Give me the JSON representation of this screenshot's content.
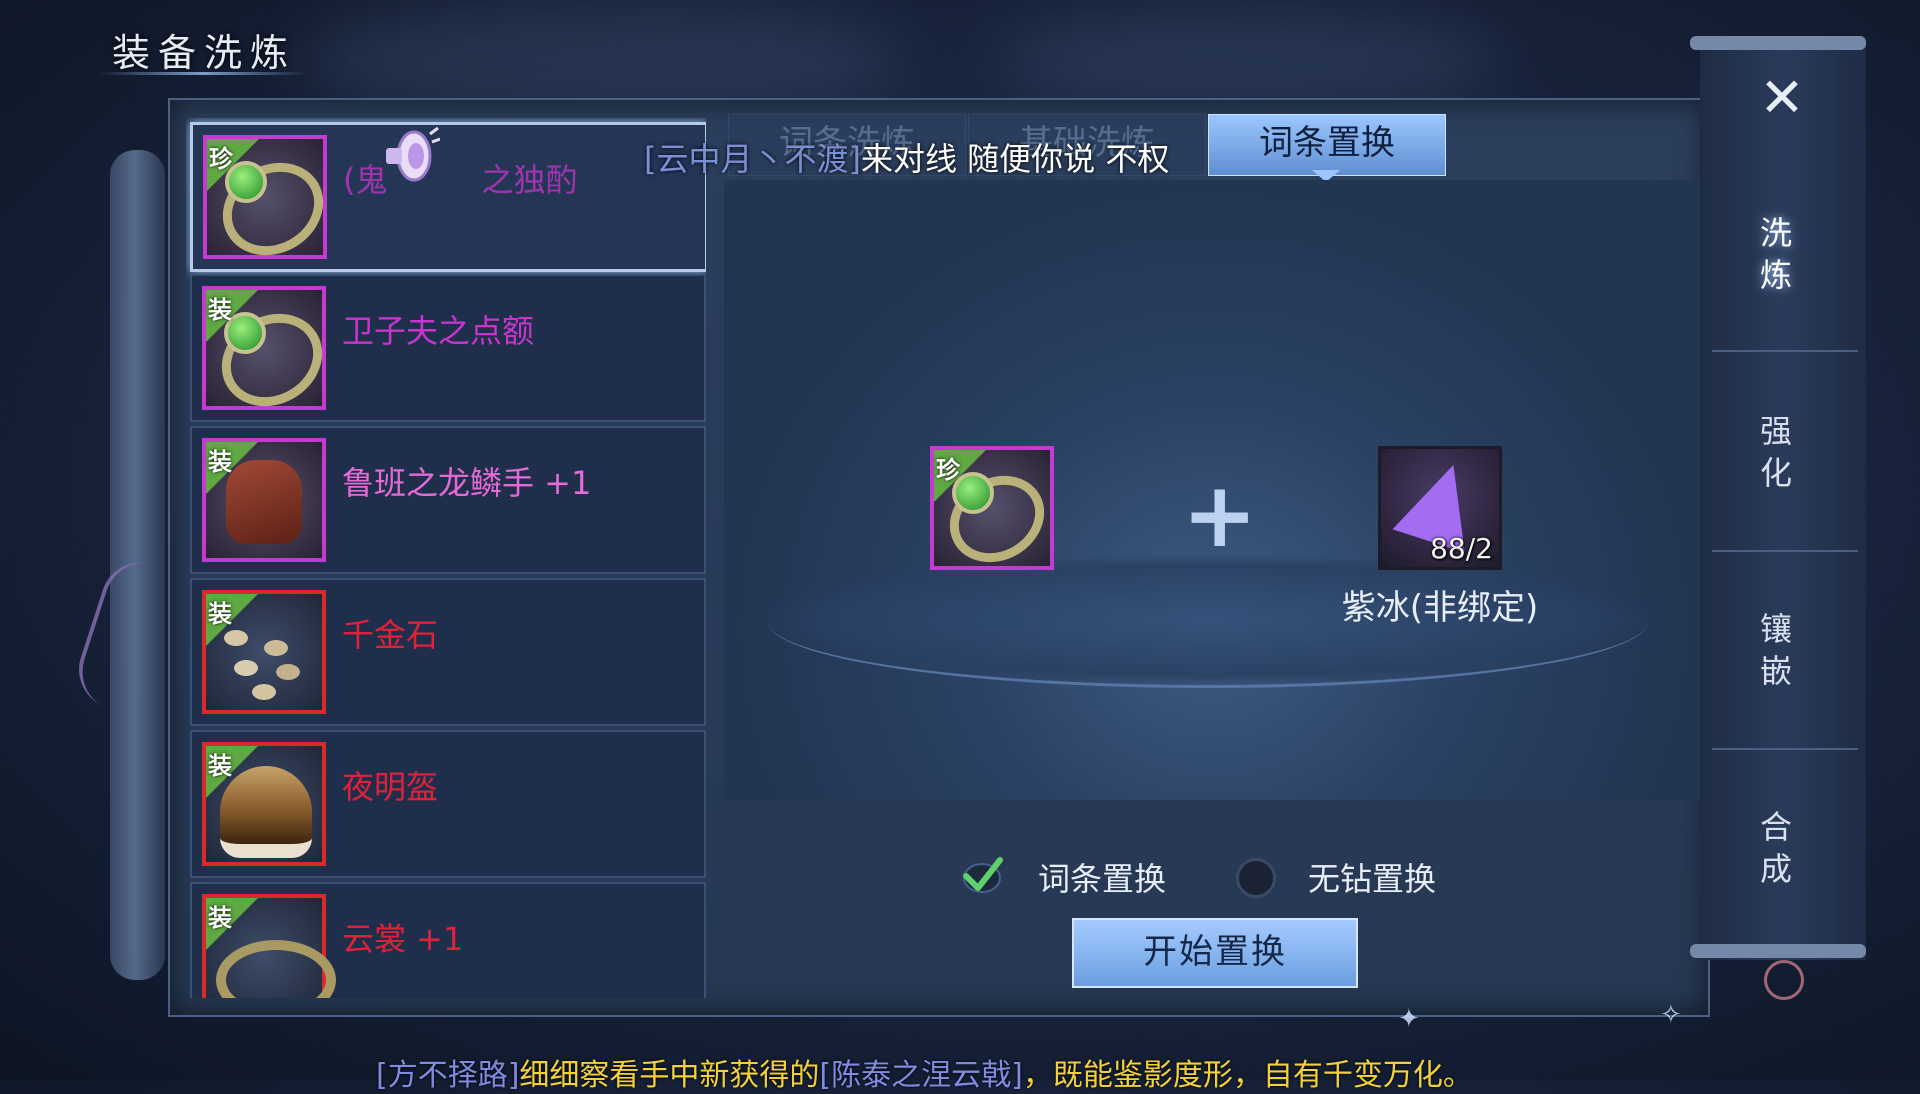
{
  "page_title": "装备洗炼",
  "items": [
    {
      "tag": "珍",
      "name": "(鬼",
      "name_rest": "之独酌",
      "color": "#c835cc",
      "frame": "purple",
      "art": "ring",
      "selected": true
    },
    {
      "tag": "装",
      "name": "卫子夫之点额",
      "color": "#c835cc",
      "frame": "purple",
      "art": "ring",
      "selected": false
    },
    {
      "tag": "装",
      "name": "鲁班之龙鳞手 +1",
      "color": "#e56ad6",
      "frame": "purple",
      "art": "glove",
      "selected": false
    },
    {
      "tag": "装",
      "name": "千金石",
      "color": "#e0213a",
      "frame": "red",
      "art": "stones",
      "selected": false
    },
    {
      "tag": "装",
      "name": "夜明盔",
      "color": "#e0213a",
      "frame": "red",
      "art": "hat",
      "selected": false
    },
    {
      "tag": "装",
      "name": "云裳 +1",
      "color": "#e0213a",
      "frame": "red",
      "art": "bracelet",
      "selected": false
    }
  ],
  "tabs": [
    {
      "label": "词条洗炼",
      "active": false
    },
    {
      "label": "基础洗炼",
      "active": false
    },
    {
      "label": "词条置换",
      "active": true
    }
  ],
  "broadcast": {
    "sender": "[云中月丶不渡]",
    "message": "来对线   随便你说 不权"
  },
  "workbench": {
    "equip_tag": "珍",
    "plus_symbol": "+",
    "material_count": "88/2",
    "material_name": "紫冰(非绑定)"
  },
  "options": [
    {
      "label": "词条置换",
      "checked": true
    },
    {
      "label": "无钻置换",
      "checked": false
    }
  ],
  "start_button": "开始置换",
  "side_tabs": [
    {
      "label": "洗\n炼",
      "active": true
    },
    {
      "label": "强\n化",
      "active": false
    },
    {
      "label": "镶\n嵌",
      "active": false
    },
    {
      "label": "合\n成",
      "active": false
    }
  ],
  "close_symbol": "✕",
  "ticker": {
    "sender": "[方不择路]",
    "text1": "细细察看手中新获得的",
    "item": "[陈泰之涅云戟]",
    "text2": "，既能鉴影度形，自有千变万化。"
  },
  "colors": {
    "purple_quality": "#c43ccf",
    "red_quality": "#d92a2a",
    "active_tab": "#9cc6ff",
    "ticker_yellow": "#f3d13c"
  }
}
